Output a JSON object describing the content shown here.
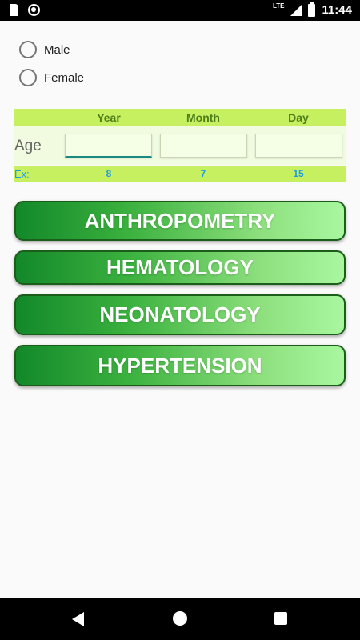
{
  "status_bar": {
    "network": "LTE",
    "time": "11:44"
  },
  "gender": {
    "options": [
      "Male",
      "Female"
    ]
  },
  "age_table": {
    "headers": [
      "Year",
      "Month",
      "Day"
    ],
    "row_label": "Age",
    "inputs": [
      {
        "value": "",
        "placeholder": ""
      },
      {
        "value": "",
        "placeholder": ""
      },
      {
        "value": "",
        "placeholder": ""
      }
    ],
    "example_label": "Ex:",
    "example_values": [
      "8",
      "7",
      "15"
    ]
  },
  "buttons": [
    "ANTHROPOMETRY",
    "HEMATOLOGY",
    "NEONATOLOGY",
    "HYPERTENSION"
  ],
  "colors": {
    "header_bg": "#c6f060",
    "button_dark": "#13882a",
    "button_light": "#a8f7a0",
    "example_text": "#1e9be0"
  },
  "icons": [
    "sd-card-icon",
    "record-icon",
    "signal-icon",
    "battery-icon",
    "back-icon",
    "home-icon",
    "recents-icon"
  ]
}
